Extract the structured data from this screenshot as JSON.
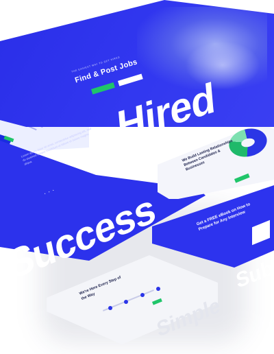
{
  "hero": {
    "tagline": "THE EASIEST WAY TO GET HIRED",
    "title": "Find & Post Jobs",
    "big_word": "Hired"
  },
  "relationships": {
    "heading": "We Build Lasting Relationships Between Candidates & Businesses"
  },
  "success": {
    "body": "Lorem ipsum dolor sit amet, consectetur adipiscing elit, sed do eiusmod tempor incididunt ut labore et dolore magna aliqua.",
    "dots": "• • •",
    "big_word": "Success"
  },
  "ebook": {
    "heading": "Get a FREE eBook on How to Prepare for Any Interview",
    "big_word": "Sub"
  },
  "steps": {
    "heading": "We're Here Every Step of the Way",
    "big_word": "Simple"
  },
  "colors": {
    "brand_blue": "#2c32ec",
    "accent_green": "#20c56a",
    "light_panel": "#f4f5f9"
  }
}
